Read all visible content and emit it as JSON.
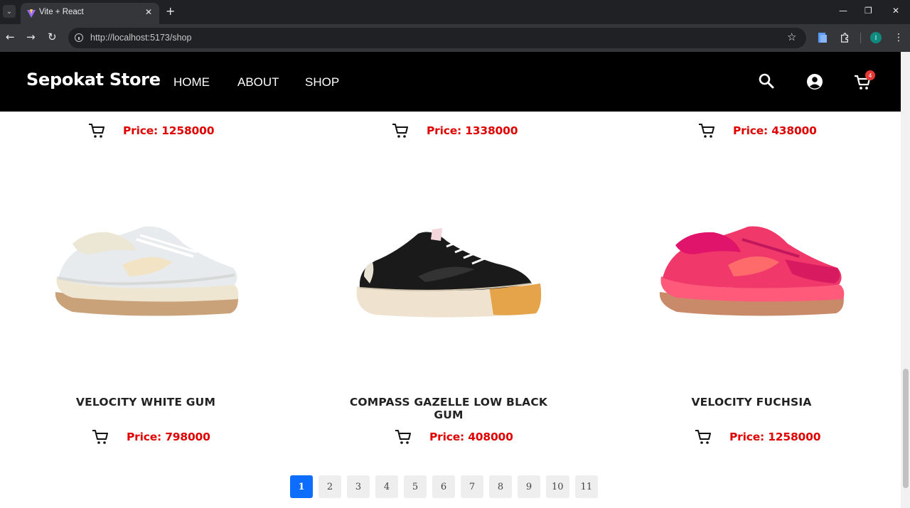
{
  "browser": {
    "tab_title": "Vite + React",
    "url": "http://localhost:5173/shop",
    "profile_initial": "I"
  },
  "site": {
    "brand": "Sepokat Store",
    "nav": [
      "HOME",
      "ABOUT",
      "SHOP"
    ],
    "cart_count": "4"
  },
  "top_prices": [
    "Price: 1258000",
    "Price: 1338000",
    "Price: 438000"
  ],
  "products": [
    {
      "name": "VELOCITY WHITE GUM",
      "price": "Price: 798000"
    },
    {
      "name": "COMPASS GAZELLE LOW BLACK GUM",
      "price": "Price: 408000"
    },
    {
      "name": "VELOCITY FUCHSIA",
      "price": "Price: 1258000"
    }
  ],
  "pagination": {
    "pages": [
      "1",
      "2",
      "3",
      "4",
      "5",
      "6",
      "7",
      "8",
      "9",
      "10",
      "11"
    ],
    "active": "1"
  },
  "colors": {
    "price": "#e00000",
    "active_page": "#0d6efd",
    "header_bg": "#000000"
  }
}
